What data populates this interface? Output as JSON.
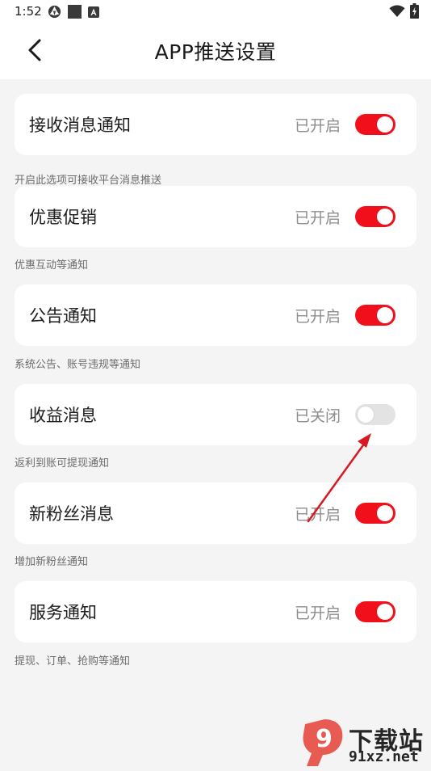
{
  "status_bar": {
    "time": "1:52",
    "left_icons": [
      "settings-app-icon",
      "square-notification-icon",
      "a-badge-icon"
    ],
    "right_icons": [
      "wifi-icon",
      "battery-charging-icon"
    ]
  },
  "header": {
    "title": "APP推送设置",
    "back_icon": "chevron-left-icon"
  },
  "settings": [
    {
      "label": "接收消息通知",
      "status": "已开启",
      "enabled": true,
      "description": "开启此选项可接收平台消息推送"
    },
    {
      "label": "优惠促销",
      "status": "已开启",
      "enabled": true,
      "description": "优惠互动等通知"
    },
    {
      "label": "公告通知",
      "status": "已开启",
      "enabled": true,
      "description": "系统公告、账号违规等通知"
    },
    {
      "label": "收益消息",
      "status": "已关闭",
      "enabled": false,
      "description": "返利到账可提现通知"
    },
    {
      "label": "新粉丝消息",
      "status": "已开启",
      "enabled": true,
      "description": "增加新粉丝通知"
    },
    {
      "label": "服务通知",
      "status": "已开启",
      "enabled": true,
      "description": "提现、订单、抢购等通知"
    }
  ],
  "watermark": {
    "title": "下载站",
    "site": "91xz.net",
    "logo_text": "9"
  },
  "colors": {
    "accent": "#f20f1c",
    "toggle_off": "#e3e3e3",
    "background": "#f4f4f4",
    "annotation_arrow": "#d71920"
  }
}
